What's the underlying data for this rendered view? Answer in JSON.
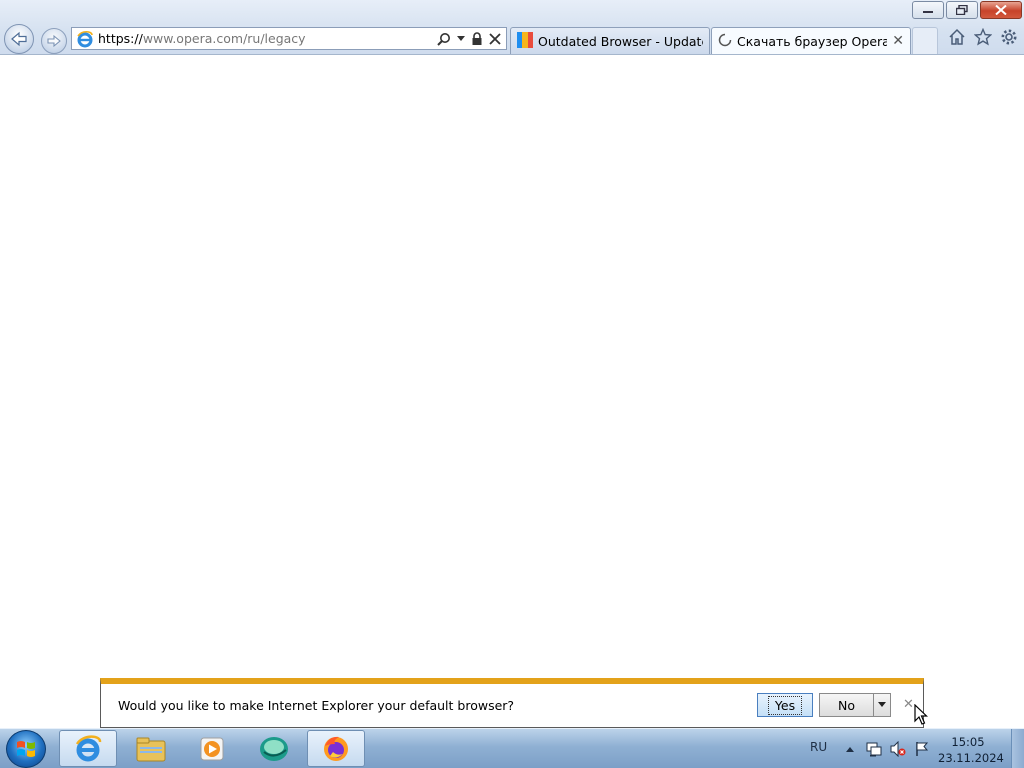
{
  "browser": {
    "address": {
      "scheme": "https://",
      "host": "www.opera.com",
      "path": "/ru/legacy"
    },
    "tabs": [
      {
        "title": "Outdated Browser - Update yo...",
        "favicon": "outdated-browser-favicon"
      },
      {
        "title": "Скачать браузер Opera дл...",
        "favicon": "loading-spinner-icon"
      }
    ],
    "window_controls": [
      "minimize",
      "restore",
      "close"
    ],
    "toolbar_icons": [
      "home-icon",
      "favorites-star-icon",
      "tools-gear-icon"
    ]
  },
  "notification": {
    "message": "Would you like to make Internet Explorer your default browser?",
    "yes_label": "Yes",
    "no_label": "No",
    "accent_color": "#e3a21a"
  },
  "taskbar": {
    "pinned": [
      "internet-explorer",
      "windows-explorer",
      "media-player",
      "app",
      "firefox"
    ],
    "language": "RU",
    "time": "15:05",
    "date": "23.11.2024"
  }
}
